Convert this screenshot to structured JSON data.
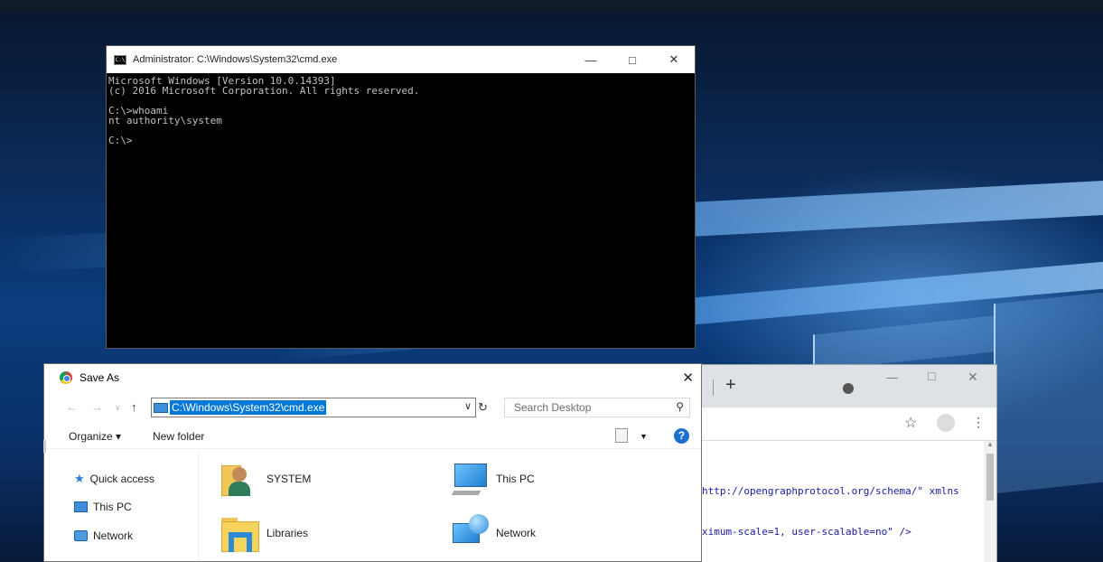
{
  "cmd_window": {
    "title": "Administrator: C:\\Windows\\System32\\cmd.exe",
    "console_lines": [
      "Microsoft Windows [Version 10.0.14393]",
      "(c) 2016 Microsoft Corporation. All rights reserved.",
      "",
      "C:\\>whoami",
      "nt authority\\system",
      "",
      "C:\\>"
    ]
  },
  "save_dialog": {
    "title": "Save As",
    "address_path": "C:\\Windows\\System32\\cmd.exe",
    "search_placeholder": "Search Desktop",
    "toolbar": {
      "organize": "Organize ▾",
      "new_folder": "New folder",
      "help": "?"
    },
    "nav_pane": [
      "Quick access",
      "This PC",
      "Network"
    ],
    "items": [
      "SYSTEM",
      "This PC",
      "Libraries",
      "Network"
    ]
  },
  "browser": {
    "new_tab": "+",
    "code_lines": [
      "http://opengraphprotocol.org/schema/\" xmlns",
      "ximum-scale=1, user-scalable=no\" />"
    ]
  },
  "colors": {
    "selection": "#0078d7",
    "desktop": "#0b3d7e"
  }
}
